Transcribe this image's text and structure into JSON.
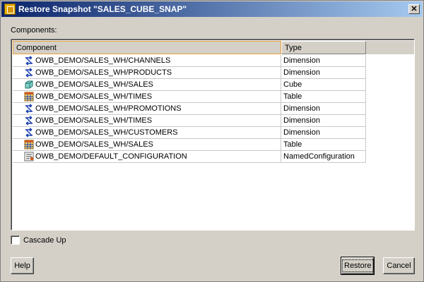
{
  "window": {
    "title": "Restore Snapshot \"SALES_CUBE_SNAP\"",
    "close_glyph": "✕"
  },
  "components_label": "Components:",
  "table": {
    "headers": {
      "component": "Component",
      "type": "Type"
    },
    "rows": [
      {
        "component": "OWB_DEMO/SALES_WH/CHANNELS",
        "type": "Dimension",
        "icon": "dimension-icon"
      },
      {
        "component": "OWB_DEMO/SALES_WH/PRODUCTS",
        "type": "Dimension",
        "icon": "dimension-icon"
      },
      {
        "component": "OWB_DEMO/SALES_WH/SALES",
        "type": "Cube",
        "icon": "cube-icon"
      },
      {
        "component": "OWB_DEMO/SALES_WH/TIMES",
        "type": "Table",
        "icon": "table-icon"
      },
      {
        "component": "OWB_DEMO/SALES_WH/PROMOTIONS",
        "type": "Dimension",
        "icon": "dimension-icon"
      },
      {
        "component": "OWB_DEMO/SALES_WH/TIMES",
        "type": "Dimension",
        "icon": "dimension-icon"
      },
      {
        "component": "OWB_DEMO/SALES_WH/CUSTOMERS",
        "type": "Dimension",
        "icon": "dimension-icon"
      },
      {
        "component": "OWB_DEMO/SALES_WH/SALES",
        "type": "Table",
        "icon": "table-icon"
      },
      {
        "component": "OWB_DEMO/DEFAULT_CONFIGURATION",
        "type": "NamedConfiguration",
        "icon": "configuration-icon"
      }
    ]
  },
  "cascade_up": {
    "label": "Cascade Up",
    "checked": false
  },
  "buttons": {
    "help": "Help",
    "restore": "Restore",
    "cancel": "Cancel"
  },
  "colors": {
    "title_start": "#0a246a",
    "title_end": "#a6caf0",
    "dialog_bg": "#d4d0c8",
    "header_focus": "#e6a23a"
  }
}
